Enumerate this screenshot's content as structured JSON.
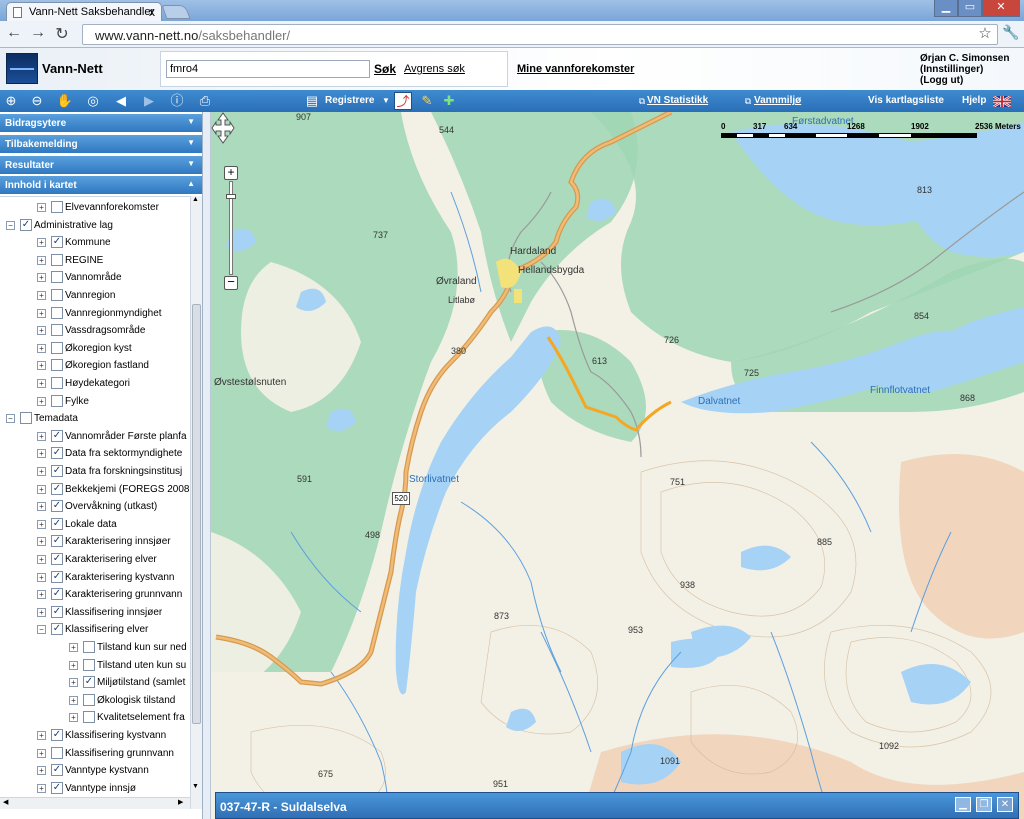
{
  "browser": {
    "tab_title": "Vann-Nett Saksbehandler",
    "tab_close": "x",
    "url_host": "www.vann-nett.no",
    "url_path": "/saksbehandler/"
  },
  "header": {
    "logo_text": "Vann-Nett",
    "search_value": "fmro4",
    "search_button": "Søk",
    "refine_link": "Avgrens søk",
    "my_waters_link": "Mine vannforekomster",
    "user_name": "Ørjan C. Simonsen",
    "settings_link": "(Innstillinger)",
    "logout_link": "(Logg ut)"
  },
  "toolbar": {
    "register_label": "Registrere",
    "statistics_link": "VN Statistikk",
    "environment_link": "Vannmiljø",
    "layer_list_link": "Vis kartlagsliste",
    "help_link": "Hjelp"
  },
  "sidebar": {
    "accordions": [
      "Bidragsytere",
      "Tilbakemelding",
      "Resultater",
      "Innhold i kartet"
    ],
    "tree": [
      {
        "label": "Elvevannforekomster",
        "level": 1,
        "checked": false,
        "expanded": false
      },
      {
        "label": "Administrative lag",
        "level": 0,
        "checked": true,
        "expanded": true
      },
      {
        "label": "Kommune",
        "level": 1,
        "checked": true,
        "expanded": false
      },
      {
        "label": "REGINE",
        "level": 1,
        "checked": false,
        "expanded": false
      },
      {
        "label": "Vannområde",
        "level": 1,
        "checked": false,
        "expanded": false
      },
      {
        "label": "Vannregion",
        "level": 1,
        "checked": false,
        "expanded": false
      },
      {
        "label": "Vannregionmyndighet",
        "level": 1,
        "checked": false,
        "expanded": false
      },
      {
        "label": "Vassdragsområde",
        "level": 1,
        "checked": false,
        "expanded": false
      },
      {
        "label": "Økoregion kyst",
        "level": 1,
        "checked": false,
        "expanded": false
      },
      {
        "label": "Økoregion fastland",
        "level": 1,
        "checked": false,
        "expanded": false
      },
      {
        "label": "Høydekategori",
        "level": 1,
        "checked": false,
        "expanded": false
      },
      {
        "label": "Fylke",
        "level": 1,
        "checked": false,
        "expanded": false
      },
      {
        "label": "Temadata",
        "level": 0,
        "checked": false,
        "expanded": true
      },
      {
        "label": "Vannområder Første planfa",
        "level": 1,
        "checked": true,
        "expanded": false
      },
      {
        "label": "Data fra sektormyndighete",
        "level": 1,
        "checked": true,
        "expanded": false
      },
      {
        "label": "Data fra forskningsinstitusj",
        "level": 1,
        "checked": true,
        "expanded": false
      },
      {
        "label": "Bekkekjemi (FOREGS 2008",
        "level": 1,
        "checked": true,
        "expanded": false
      },
      {
        "label": "Overvåkning (utkast)",
        "level": 1,
        "checked": true,
        "expanded": false
      },
      {
        "label": "Lokale data",
        "level": 1,
        "checked": true,
        "expanded": false
      },
      {
        "label": "Karakterisering innsjøer",
        "level": 1,
        "checked": true,
        "expanded": false
      },
      {
        "label": "Karakterisering elver",
        "level": 1,
        "checked": true,
        "expanded": false
      },
      {
        "label": "Karakterisering kystvann",
        "level": 1,
        "checked": true,
        "expanded": false
      },
      {
        "label": "Karakterisering grunnvann",
        "level": 1,
        "checked": true,
        "expanded": false
      },
      {
        "label": "Klassifisering innsjøer",
        "level": 1,
        "checked": true,
        "expanded": false
      },
      {
        "label": "Klassifisering elver",
        "level": 1,
        "checked": true,
        "expanded": true
      },
      {
        "label": "Tilstand kun sur ned",
        "level": 2,
        "checked": false,
        "expanded": false
      },
      {
        "label": "Tilstand uten kun su",
        "level": 2,
        "checked": false,
        "expanded": false
      },
      {
        "label": "Miljøtilstand (samlet",
        "level": 2,
        "checked": true,
        "expanded": false
      },
      {
        "label": "Økologisk tilstand",
        "level": 2,
        "checked": false,
        "expanded": false
      },
      {
        "label": "Kvalitetselement fra",
        "level": 2,
        "checked": false,
        "expanded": false
      },
      {
        "label": "Klassifisering kystvann",
        "level": 1,
        "checked": true,
        "expanded": false
      },
      {
        "label": "Klassifisering grunnvann",
        "level": 1,
        "checked": false,
        "expanded": false
      },
      {
        "label": "Vanntype kystvann",
        "level": 1,
        "checked": true,
        "expanded": false
      },
      {
        "label": "Vanntype innsjø",
        "level": 1,
        "checked": true,
        "expanded": false
      }
    ]
  },
  "map": {
    "scale_labels": [
      "0",
      "317",
      "634",
      "1268",
      "1902",
      "2536 Meters"
    ],
    "place_labels": [
      "Hardaland",
      "Hellandsbygda",
      "Øvraland",
      "Litlabø",
      "Øvstestølsnuten",
      "Førstadvatnet"
    ],
    "water_labels": [
      "Storlivatnet",
      "Dalvatnet",
      "Finnflotvatnet"
    ],
    "heights": [
      "907",
      "544",
      "737",
      "813",
      "854",
      "726",
      "725",
      "613",
      "380",
      "868",
      "591",
      "751",
      "498",
      "885",
      "938",
      "873",
      "953",
      "1092",
      "1091",
      "675",
      "951"
    ],
    "road_number": "520",
    "colors": {
      "water": "#a6d3f5",
      "forest": "#9fd6b4",
      "road": "#e0a14f",
      "highlight": "#f5a623",
      "land": "#f3f1e6"
    }
  },
  "bottom_panel": {
    "title": "037-47-R - Suldalselva",
    "buttons": [
      "minimize",
      "restore",
      "close"
    ]
  }
}
